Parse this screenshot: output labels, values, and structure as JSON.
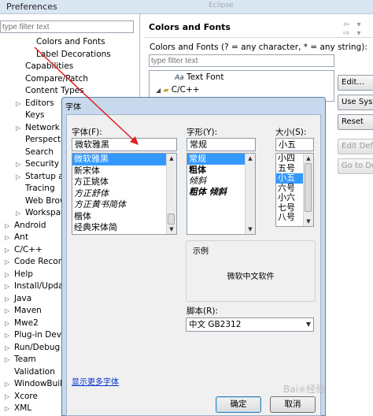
{
  "preferences": {
    "title": "Preferences",
    "faint_text": "Eclipse",
    "filter_placeholder": "type filter text"
  },
  "tree": [
    {
      "label": "Colors and Fonts",
      "indent": 2,
      "expander": ""
    },
    {
      "label": "Label Decorations",
      "indent": 2,
      "expander": ""
    },
    {
      "label": "Capabilities",
      "indent": 1,
      "expander": ""
    },
    {
      "label": "Compare/Patch",
      "indent": 1,
      "expander": ""
    },
    {
      "label": "Content Types",
      "indent": 1,
      "expander": ""
    },
    {
      "label": "Editors",
      "indent": 1,
      "expander": "▷"
    },
    {
      "label": "Keys",
      "indent": 1,
      "expander": ""
    },
    {
      "label": "Network C",
      "indent": 1,
      "expander": "▷"
    },
    {
      "label": "Perspectiv",
      "indent": 1,
      "expander": ""
    },
    {
      "label": "Search",
      "indent": 1,
      "expander": ""
    },
    {
      "label": "Security",
      "indent": 1,
      "expander": "▷"
    },
    {
      "label": "Startup ar",
      "indent": 1,
      "expander": "▷"
    },
    {
      "label": "Tracing",
      "indent": 1,
      "expander": ""
    },
    {
      "label": "Web Brow",
      "indent": 1,
      "expander": ""
    },
    {
      "label": "Workspac",
      "indent": 1,
      "expander": "▷"
    },
    {
      "label": "Android",
      "indent": 0,
      "expander": "▷"
    },
    {
      "label": "Ant",
      "indent": 0,
      "expander": "▷"
    },
    {
      "label": "C/C++",
      "indent": 0,
      "expander": "▷"
    },
    {
      "label": "Code Recom",
      "indent": 0,
      "expander": "▷"
    },
    {
      "label": "Help",
      "indent": 0,
      "expander": "▷"
    },
    {
      "label": "Install/Updat",
      "indent": 0,
      "expander": "▷"
    },
    {
      "label": "Java",
      "indent": 0,
      "expander": "▷"
    },
    {
      "label": "Maven",
      "indent": 0,
      "expander": "▷"
    },
    {
      "label": "Mwe2",
      "indent": 0,
      "expander": "▷"
    },
    {
      "label": "Plug-in Devel",
      "indent": 0,
      "expander": "▷"
    },
    {
      "label": "Run/Debug",
      "indent": 0,
      "expander": "▷"
    },
    {
      "label": "Team",
      "indent": 0,
      "expander": "▷"
    },
    {
      "label": "Validation",
      "indent": 0,
      "expander": ""
    },
    {
      "label": "WindowBuild",
      "indent": 0,
      "expander": "▷"
    },
    {
      "label": "Xcore",
      "indent": 0,
      "expander": "▷"
    },
    {
      "label": "XML",
      "indent": 0,
      "expander": "▷"
    }
  ],
  "right": {
    "title": "Colors and Fonts",
    "nav": "⇦ ▾ ⇨ ▾",
    "description": "Colors and Fonts (? = any character, * = any string):",
    "filter_placeholder": "type filter text",
    "list_items": [
      {
        "label": "Text Font",
        "prefix": "Aa"
      },
      {
        "label": "C/C++",
        "prefix": "▲"
      }
    ],
    "buttons": [
      {
        "label": "Edit...",
        "disabled": false
      },
      {
        "label": "Use System",
        "disabled": false
      },
      {
        "label": "Reset",
        "disabled": false
      },
      {
        "label": "Edit Default...",
        "disabled": true
      },
      {
        "label": "Go to Default",
        "disabled": true
      }
    ]
  },
  "dialog": {
    "title": "字体",
    "font_label": "字体(F):",
    "font_value": "微软雅黑",
    "font_options": [
      "微软雅黑",
      "新宋体",
      "方正姚体",
      "方正舒体",
      "方正黄书简体",
      "楷体",
      "经典宋体简"
    ],
    "font_selected": 0,
    "style_label": "字形(Y):",
    "style_value": "常规",
    "style_options": [
      "常规",
      "粗体",
      "倾斜",
      "粗体 倾斜"
    ],
    "style_selected": 0,
    "size_label": "大小(S):",
    "size_value": "小五",
    "size_options": [
      "小四",
      "五号",
      "小五",
      "六号",
      "小六",
      "七号",
      "八号"
    ],
    "size_selected": 2,
    "sample_label": "示例",
    "sample_text": "微软中文软件",
    "script_label": "脚本(R):",
    "script_value": "中文 GB2312",
    "more_fonts_link": "显示更多字体",
    "ok_label": "确定",
    "cancel_label": "取消"
  },
  "watermark": "Bai du 经验",
  "colors": {
    "selection": "#3399ff",
    "annotation_arrow": "#e02020",
    "link": "#0033cc"
  }
}
